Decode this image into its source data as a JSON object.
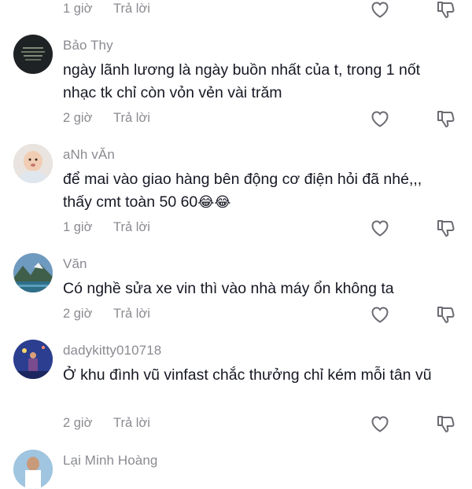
{
  "comments": [
    {
      "username": "",
      "text": "",
      "time": "1 giờ",
      "reply_label": "Trả lời",
      "icons": {
        "like": "heart-outline-icon",
        "dislike": "thumbs-down-outline-icon"
      }
    },
    {
      "username": "Bảo Thy",
      "text": "ngày lãnh lương là ngày buồn nhất của t, trong 1 nốt nhạc tk chỉ còn vỏn vẻn vài trăm",
      "time": "2 giờ",
      "reply_label": "Trả lời"
    },
    {
      "username": "aNh vĂn",
      "text": "để mai vào giao hàng bên động cơ điện hỏi đã nhé,,, thấy cmt toàn 50 60",
      "emoji": "😂😂",
      "time": "1 giờ",
      "reply_label": "Trả lời"
    },
    {
      "username": "Văn",
      "text": "Có nghề sửa xe vin thì vào nhà máy ổn không ta",
      "time": "2 giờ",
      "reply_label": "Trả lời"
    },
    {
      "username": "dadykitty010718",
      "text": "Ở khu đình vũ vinfast chắc thưởng chỉ kém mỗi tân vũ",
      "time": "2 giờ",
      "reply_label": "Trả lời"
    },
    {
      "username": "Lại Minh Hoàng"
    }
  ],
  "colors": {
    "text": "#161823",
    "meta": "#8a8b91",
    "icon": "#6b6c72"
  }
}
